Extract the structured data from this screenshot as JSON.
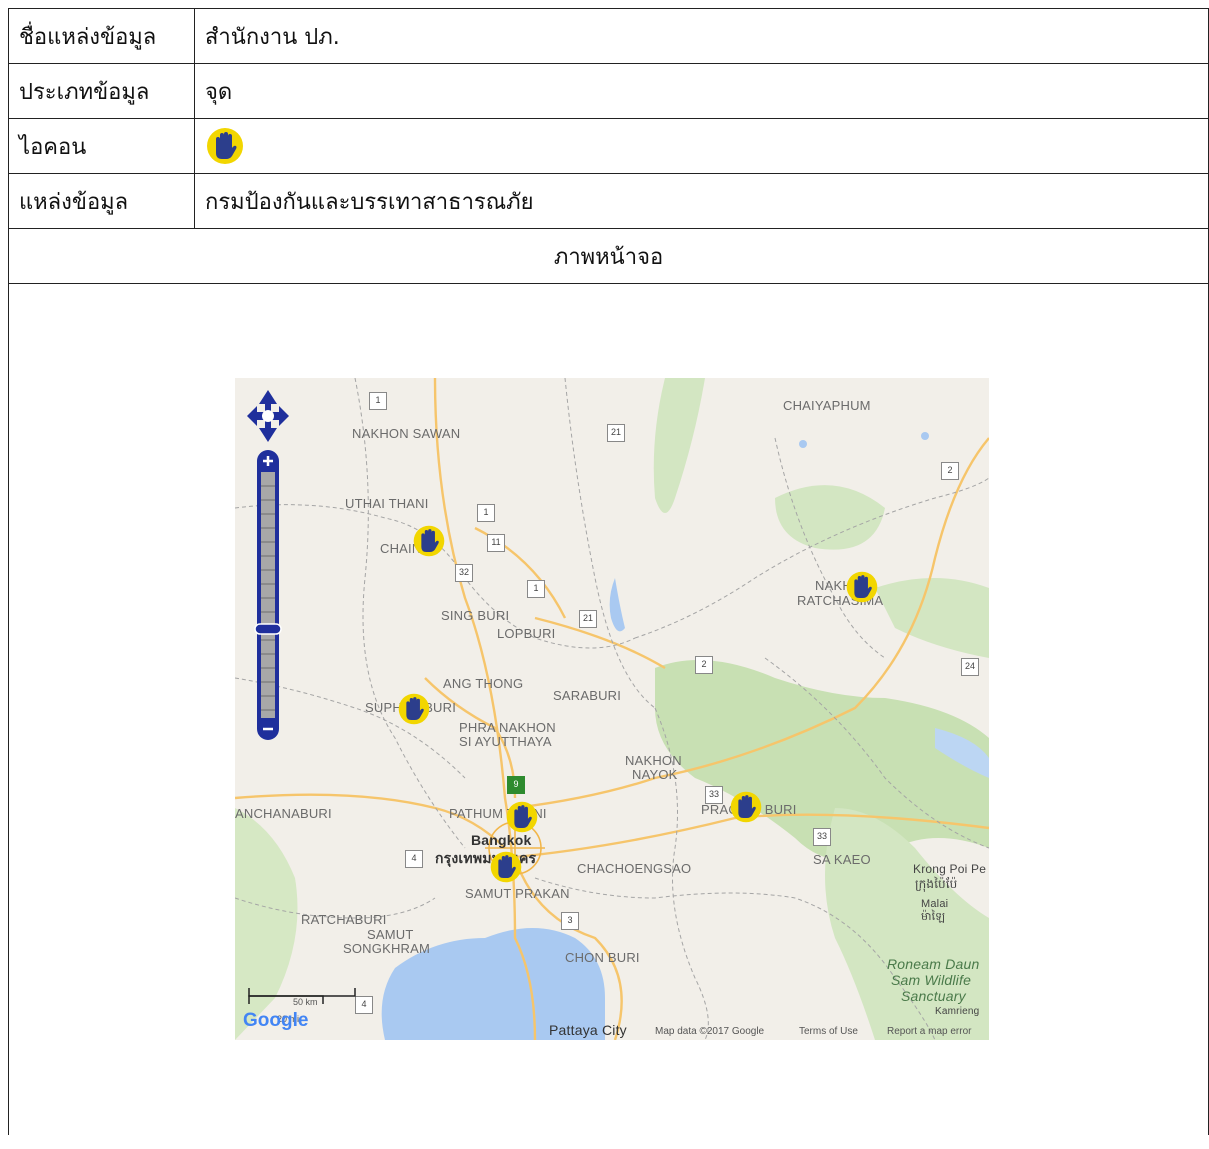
{
  "table": {
    "rows": [
      {
        "label": "ชื่อแหล่งข้อมูล",
        "value": "สำนักงาน ปภ."
      },
      {
        "label": "ประเภทข้อมูล",
        "value": "จุด"
      },
      {
        "label": "ไอคอน",
        "value": ""
      },
      {
        "label": "แหล่งข้อมูล",
        "value": "กรมป้องกันและบรรเทาสาธารณภัย"
      }
    ],
    "screenshot_header": "ภาพหน้าจอ"
  },
  "colors": {
    "marker_yellow": "#f2d600",
    "marker_hand": "#2c3e8c",
    "zoom_blue": "#1f2f9c",
    "water": "#a9c9f1",
    "forest": "#c8e0b3",
    "land": "#f2efe9"
  },
  "map": {
    "icons": {
      "marker": "hand-marker-icon",
      "pan": "pan-arrows-icon",
      "zoom_in": "zoom-in-icon",
      "zoom_out": "zoom-out-icon"
    },
    "labels": {
      "nakhon_sawan": "NAKHON SAWAN",
      "chaiyaphum": "CHAIYAPHUM",
      "uthai_thani": "UTHAI THANI",
      "chainat": "CHAINAT",
      "nakhon_ratchasima_1": "NAKHON",
      "nakhon_ratchasima_2": "RATCHASIMA",
      "sing_buri": "SING BURI",
      "lopburi": "LOPBURI",
      "ang_thong": "ANG THONG",
      "saraburi": "SARABURI",
      "suphan_buri": "SUPHAN BURI",
      "phra_nakhon_1": "PHRA NAKHON",
      "phra_nakhon_2": "SI AYUTTHAYA",
      "nakhon_nayok_1": "NAKHON",
      "nakhon_nayok_2": "NAYOK",
      "kanchanaburi": "ANCHANABURI",
      "pathum_thani": "PATHUM THANI",
      "prachin_buri": "PRACHIN BURI",
      "bangkok_en": "Bangkok",
      "bangkok_th": "กรุงเทพมหานคร",
      "sa_kaeo": "SA KAEO",
      "chachoengsao": "CHACHOENGSAO",
      "krong_poi": "Krong Poi Pe",
      "krong_poi_km": "ក្រុងប៉ៃប៉ែ",
      "malai": "Malai",
      "malai_km": "ម៉ាឡៃ",
      "samut_prakan": "SAMUT PRAKAN",
      "ratchaburi": "RATCHABURI",
      "samut_songkhram_1": "SAMUT",
      "samut_songkhram_2": "SONGKHRAM",
      "chon_buri": "CHON BURI",
      "roneam_1": "Roneam Daun",
      "roneam_2": "Sam Wildlife",
      "roneam_3": "Sanctuary",
      "pattaya": "Pattaya City",
      "kamrieng": "Kamrieng"
    },
    "road_shields": [
      "1",
      "21",
      "2",
      "1",
      "11",
      "32",
      "1",
      "21",
      "2",
      "24",
      "9",
      "33",
      "33",
      "4",
      "3",
      "4"
    ],
    "scale": {
      "km": "50 km",
      "mi": "20 mi"
    },
    "google_logo": "Google",
    "footer": {
      "map_data": "Map data ©2017 Google",
      "terms": "Terms of Use",
      "report": "Report a map error"
    }
  }
}
